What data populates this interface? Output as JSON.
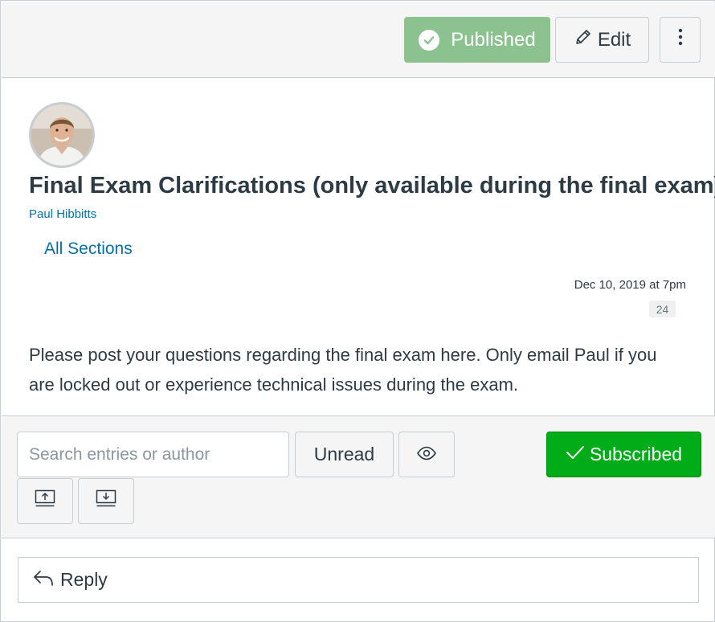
{
  "toolbar": {
    "published_label": "Published",
    "edit_label": "Edit",
    "published_color": "#8cc28f"
  },
  "topic": {
    "title": "Final Exam Clarifications (only available during the final exam)",
    "author": "Paul Hibbitts",
    "sections": "All Sections",
    "date": "Dec 10, 2019 at 7pm",
    "reply_count": "24",
    "message": "Please post your questions regarding the final exam here. Only email Paul if you are locked out or experience technical issues during the exam."
  },
  "filters": {
    "search_placeholder": "Search entries or author",
    "unread_label": "Unread",
    "subscribed_label": "Subscribed",
    "subscribed_color": "#00ac18"
  },
  "reply": {
    "label": "Reply"
  },
  "icons": {
    "published": "check-circle-icon",
    "edit": "pencil-icon",
    "more": "more-vertical-icon",
    "eye": "eye-icon",
    "subscribed": "checkmark-icon",
    "collapse": "collapse-all-icon",
    "expand": "expand-all-icon",
    "reply": "reply-arrow-icon"
  }
}
